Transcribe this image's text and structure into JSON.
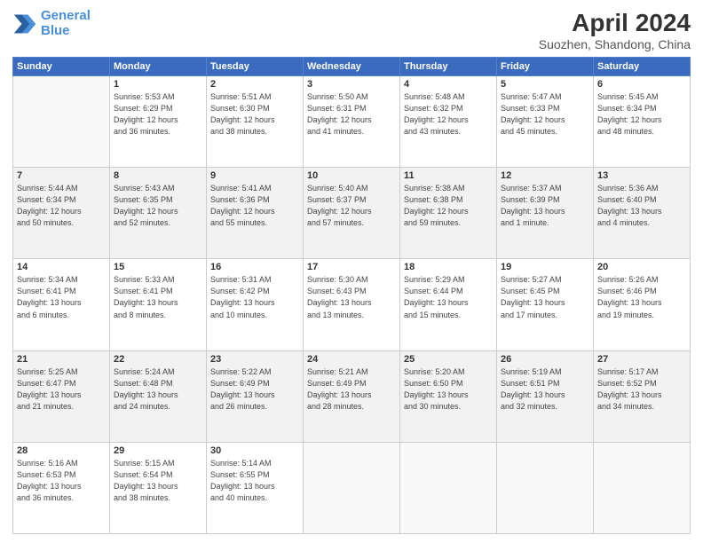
{
  "header": {
    "logo_line1": "General",
    "logo_line2": "Blue",
    "title": "April 2024",
    "subtitle": "Suozhen, Shandong, China"
  },
  "columns": [
    "Sunday",
    "Monday",
    "Tuesday",
    "Wednesday",
    "Thursday",
    "Friday",
    "Saturday"
  ],
  "weeks": [
    {
      "shade": false,
      "days": [
        {
          "num": "",
          "info": ""
        },
        {
          "num": "1",
          "info": "Sunrise: 5:53 AM\nSunset: 6:29 PM\nDaylight: 12 hours\nand 36 minutes."
        },
        {
          "num": "2",
          "info": "Sunrise: 5:51 AM\nSunset: 6:30 PM\nDaylight: 12 hours\nand 38 minutes."
        },
        {
          "num": "3",
          "info": "Sunrise: 5:50 AM\nSunset: 6:31 PM\nDaylight: 12 hours\nand 41 minutes."
        },
        {
          "num": "4",
          "info": "Sunrise: 5:48 AM\nSunset: 6:32 PM\nDaylight: 12 hours\nand 43 minutes."
        },
        {
          "num": "5",
          "info": "Sunrise: 5:47 AM\nSunset: 6:33 PM\nDaylight: 12 hours\nand 45 minutes."
        },
        {
          "num": "6",
          "info": "Sunrise: 5:45 AM\nSunset: 6:34 PM\nDaylight: 12 hours\nand 48 minutes."
        }
      ]
    },
    {
      "shade": true,
      "days": [
        {
          "num": "7",
          "info": "Sunrise: 5:44 AM\nSunset: 6:34 PM\nDaylight: 12 hours\nand 50 minutes."
        },
        {
          "num": "8",
          "info": "Sunrise: 5:43 AM\nSunset: 6:35 PM\nDaylight: 12 hours\nand 52 minutes."
        },
        {
          "num": "9",
          "info": "Sunrise: 5:41 AM\nSunset: 6:36 PM\nDaylight: 12 hours\nand 55 minutes."
        },
        {
          "num": "10",
          "info": "Sunrise: 5:40 AM\nSunset: 6:37 PM\nDaylight: 12 hours\nand 57 minutes."
        },
        {
          "num": "11",
          "info": "Sunrise: 5:38 AM\nSunset: 6:38 PM\nDaylight: 12 hours\nand 59 minutes."
        },
        {
          "num": "12",
          "info": "Sunrise: 5:37 AM\nSunset: 6:39 PM\nDaylight: 13 hours\nand 1 minute."
        },
        {
          "num": "13",
          "info": "Sunrise: 5:36 AM\nSunset: 6:40 PM\nDaylight: 13 hours\nand 4 minutes."
        }
      ]
    },
    {
      "shade": false,
      "days": [
        {
          "num": "14",
          "info": "Sunrise: 5:34 AM\nSunset: 6:41 PM\nDaylight: 13 hours\nand 6 minutes."
        },
        {
          "num": "15",
          "info": "Sunrise: 5:33 AM\nSunset: 6:41 PM\nDaylight: 13 hours\nand 8 minutes."
        },
        {
          "num": "16",
          "info": "Sunrise: 5:31 AM\nSunset: 6:42 PM\nDaylight: 13 hours\nand 10 minutes."
        },
        {
          "num": "17",
          "info": "Sunrise: 5:30 AM\nSunset: 6:43 PM\nDaylight: 13 hours\nand 13 minutes."
        },
        {
          "num": "18",
          "info": "Sunrise: 5:29 AM\nSunset: 6:44 PM\nDaylight: 13 hours\nand 15 minutes."
        },
        {
          "num": "19",
          "info": "Sunrise: 5:27 AM\nSunset: 6:45 PM\nDaylight: 13 hours\nand 17 minutes."
        },
        {
          "num": "20",
          "info": "Sunrise: 5:26 AM\nSunset: 6:46 PM\nDaylight: 13 hours\nand 19 minutes."
        }
      ]
    },
    {
      "shade": true,
      "days": [
        {
          "num": "21",
          "info": "Sunrise: 5:25 AM\nSunset: 6:47 PM\nDaylight: 13 hours\nand 21 minutes."
        },
        {
          "num": "22",
          "info": "Sunrise: 5:24 AM\nSunset: 6:48 PM\nDaylight: 13 hours\nand 24 minutes."
        },
        {
          "num": "23",
          "info": "Sunrise: 5:22 AM\nSunset: 6:49 PM\nDaylight: 13 hours\nand 26 minutes."
        },
        {
          "num": "24",
          "info": "Sunrise: 5:21 AM\nSunset: 6:49 PM\nDaylight: 13 hours\nand 28 minutes."
        },
        {
          "num": "25",
          "info": "Sunrise: 5:20 AM\nSunset: 6:50 PM\nDaylight: 13 hours\nand 30 minutes."
        },
        {
          "num": "26",
          "info": "Sunrise: 5:19 AM\nSunset: 6:51 PM\nDaylight: 13 hours\nand 32 minutes."
        },
        {
          "num": "27",
          "info": "Sunrise: 5:17 AM\nSunset: 6:52 PM\nDaylight: 13 hours\nand 34 minutes."
        }
      ]
    },
    {
      "shade": false,
      "days": [
        {
          "num": "28",
          "info": "Sunrise: 5:16 AM\nSunset: 6:53 PM\nDaylight: 13 hours\nand 36 minutes."
        },
        {
          "num": "29",
          "info": "Sunrise: 5:15 AM\nSunset: 6:54 PM\nDaylight: 13 hours\nand 38 minutes."
        },
        {
          "num": "30",
          "info": "Sunrise: 5:14 AM\nSunset: 6:55 PM\nDaylight: 13 hours\nand 40 minutes."
        },
        {
          "num": "",
          "info": ""
        },
        {
          "num": "",
          "info": ""
        },
        {
          "num": "",
          "info": ""
        },
        {
          "num": "",
          "info": ""
        }
      ]
    }
  ]
}
